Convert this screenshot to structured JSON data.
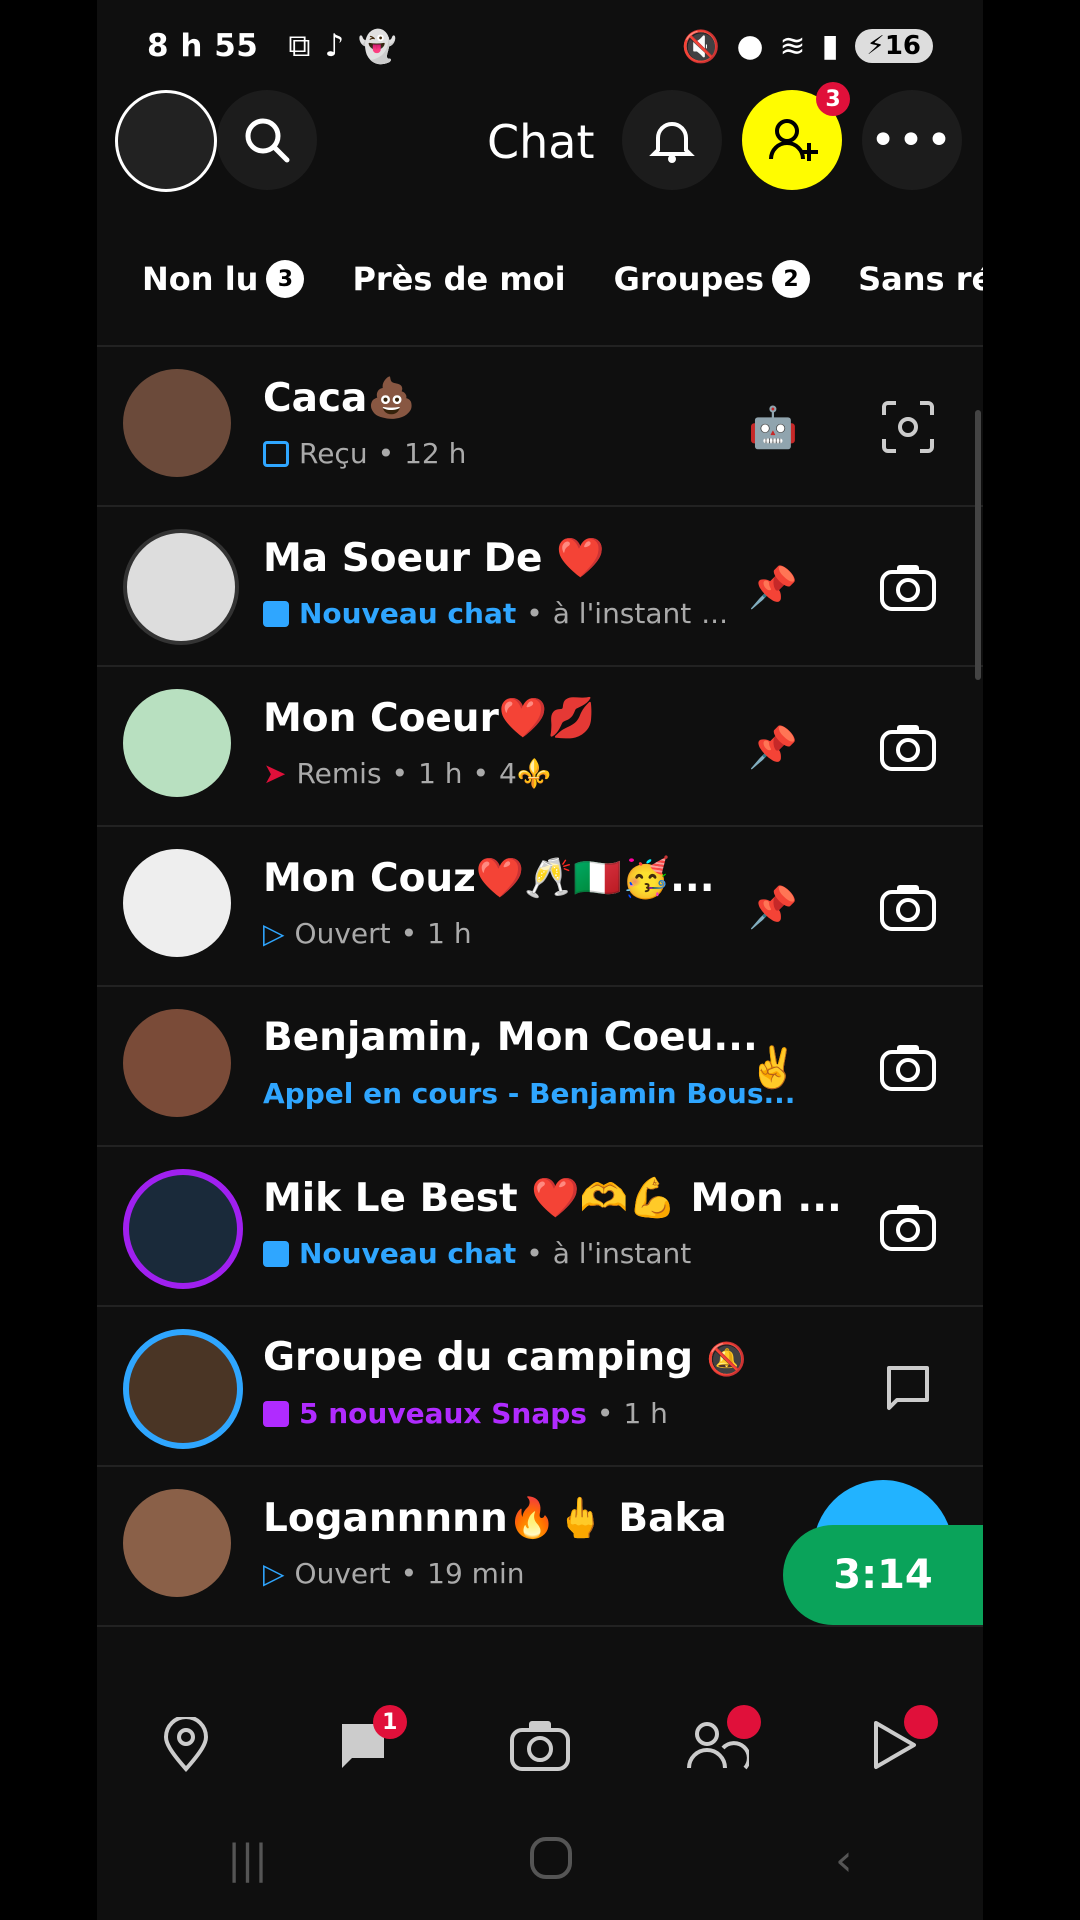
{
  "status": {
    "time": "8 h 55",
    "battery": "16"
  },
  "header": {
    "title": "Chat",
    "friend_requests_count": "3"
  },
  "tabs": [
    {
      "label": "Non lu",
      "count": "3"
    },
    {
      "label": "Près de moi",
      "count": ""
    },
    {
      "label": "Groupes",
      "count": "2"
    },
    {
      "label": "Sans répo",
      "count": ""
    }
  ],
  "chats": [
    {
      "name": "Caca💩",
      "status_label": "Reçu",
      "time": "12 h",
      "extra": "",
      "right_emoji": "🤖"
    },
    {
      "name": "Ma Soeur De ❤️",
      "status_label": "Nouveau chat",
      "time": "à l'instant",
      "extra": "...",
      "right_emoji": ""
    },
    {
      "name": "Mon Coeur❤️💋",
      "status_label": "Remis",
      "time": "1 h",
      "extra": "4⚜️",
      "right_emoji": ""
    },
    {
      "name": "Mon Couz❤️🥂🇮🇹🥳...",
      "status_label": "Ouvert",
      "time": "1 h",
      "extra": "",
      "right_emoji": ""
    },
    {
      "name": "Benjamin, Mon Coeu...",
      "status_label": "Appel en cours - Benjamin Bous...",
      "time": "",
      "extra": "",
      "right_emoji": "✌️"
    },
    {
      "name": "Mik Le Best ❤️🫶💪 Mon ...",
      "status_label": "Nouveau chat",
      "time": "à l'instant",
      "extra": "",
      "right_emoji": ""
    },
    {
      "name": "Groupe du camping",
      "status_label": "5 nouveaux Snaps",
      "time": "1 h",
      "extra": "",
      "right_emoji": ""
    },
    {
      "name": "Logannnnn🔥🖕 Baka",
      "status_label": "Ouvert",
      "time": "19 min",
      "extra": "",
      "right_emoji": ""
    }
  ],
  "timer": "3:14",
  "nav": {
    "chat_badge": "1"
  },
  "colors": {
    "accent_yellow": "#fffc00",
    "blue": "#2fa6ff",
    "red": "#e0103a",
    "purple": "#b02bff",
    "green": "#0aa35a"
  }
}
